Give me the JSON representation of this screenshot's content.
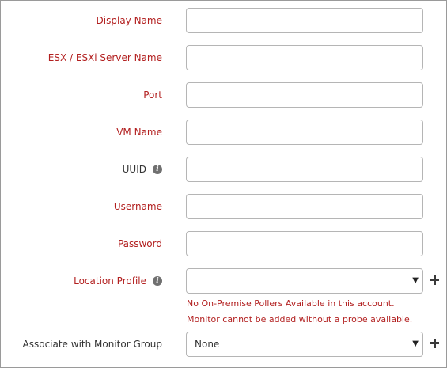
{
  "form": {
    "fields": {
      "display_name": {
        "label": "Display Name",
        "value": ""
      },
      "server_name": {
        "label": "ESX / ESXi Server Name",
        "value": ""
      },
      "port": {
        "label": "Port",
        "value": ""
      },
      "vm_name": {
        "label": "VM Name",
        "value": ""
      },
      "uuid": {
        "label": "UUID",
        "value": ""
      },
      "username": {
        "label": "Username",
        "value": ""
      },
      "password": {
        "label": "Password",
        "value": ""
      },
      "location_profile": {
        "label": "Location Profile",
        "selected": ""
      },
      "monitor_group": {
        "label": "Associate with Monitor Group",
        "selected": "None"
      }
    },
    "warnings": {
      "no_pollers": "No On-Premise Pollers Available in this account.",
      "no_probe": "Monitor cannot be added without a probe available."
    },
    "icons": {
      "info": "info-icon",
      "add": "plus-icon",
      "dropdown": "chevron-down-icon"
    },
    "colors": {
      "required_label": "#b21f1f",
      "optional_label": "#333333",
      "border": "#b5b5b5",
      "icon": "#707070"
    }
  }
}
